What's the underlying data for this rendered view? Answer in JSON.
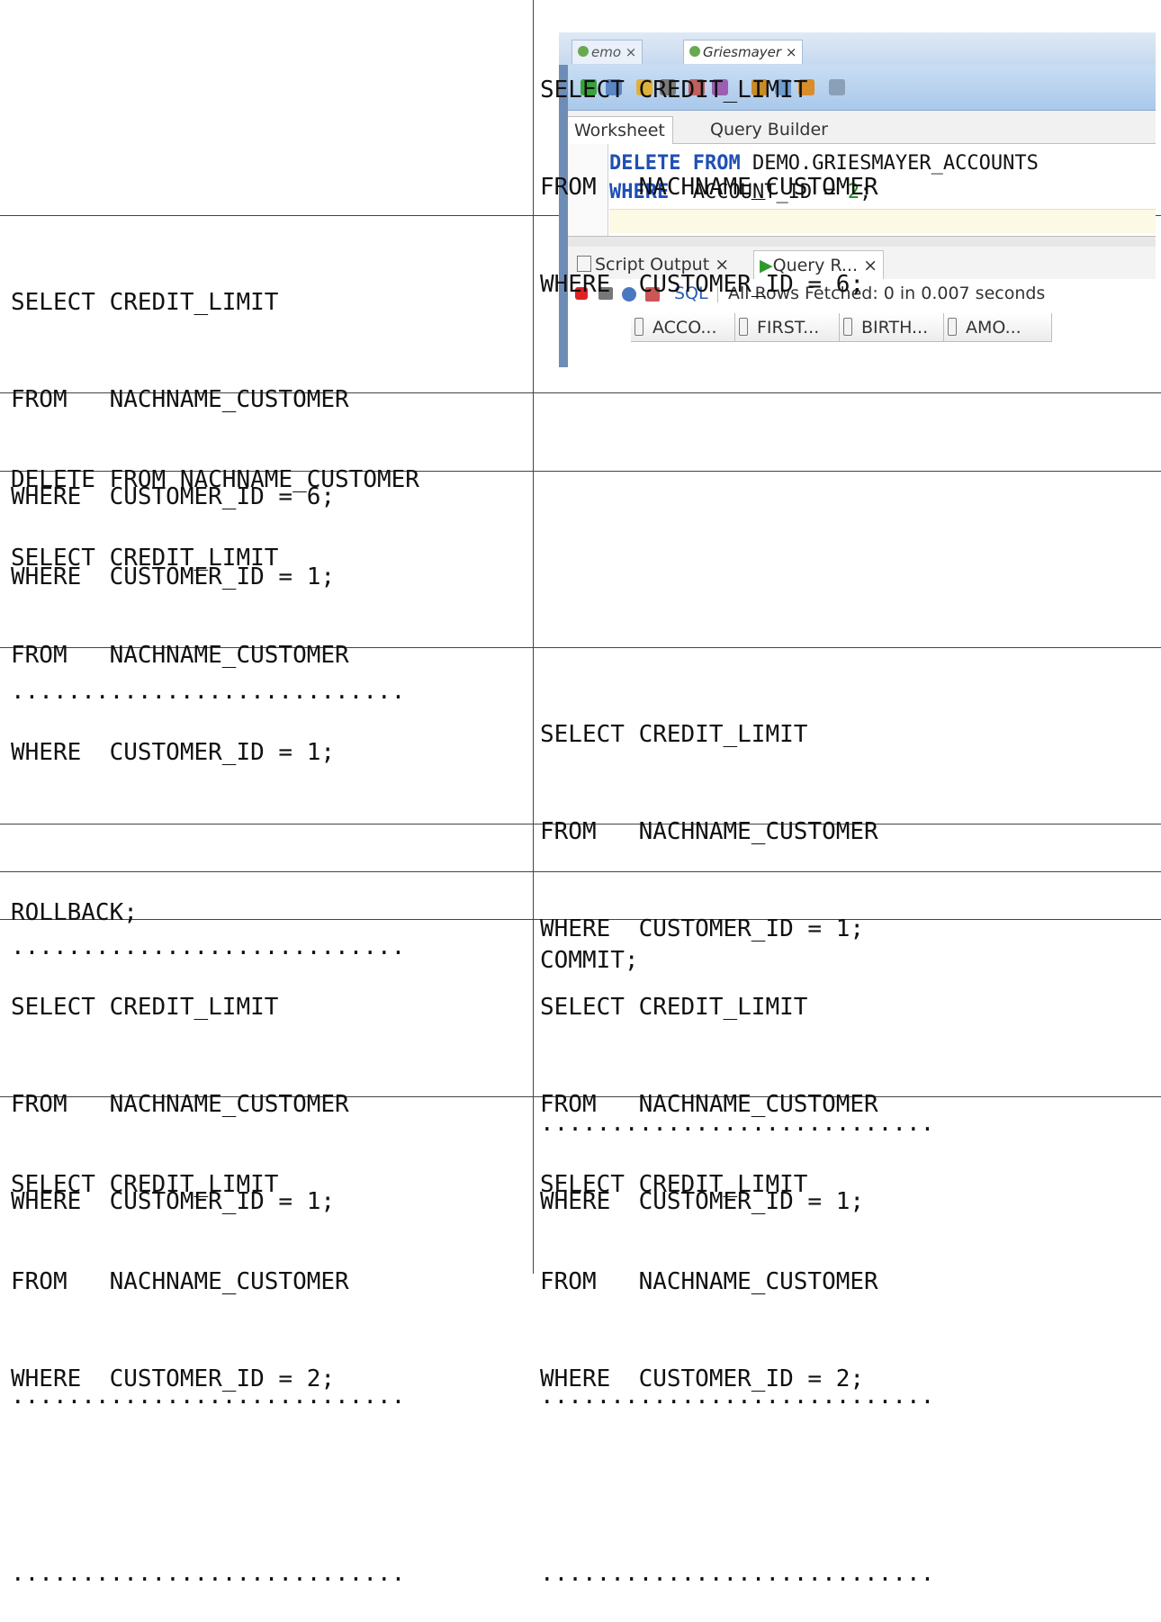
{
  "rows": [
    {
      "left": [],
      "right": [
        "SELECT CREDIT_LIMIT",
        "FROM   NACHNAME_CUSTOMER",
        "WHERE  CUSTOMER_ID = 6;"
      ],
      "right_dots": "............................"
    },
    {
      "left": [
        "SELECT CREDIT_LIMIT",
        "FROM   NACHNAME_CUSTOMER",
        "WHERE  CUSTOMER_ID = 6;"
      ],
      "left_dots": "............................",
      "right": []
    },
    {
      "left": [
        "DELETE FROM NACHNAME_CUSTOMER",
        "WHERE  CUSTOMER_ID = 1;"
      ],
      "right": []
    },
    {
      "left": [
        "SELECT CREDIT_LIMIT",
        "FROM   NACHNAME_CUSTOMER",
        "WHERE  CUSTOMER_ID = 1;"
      ],
      "left_dots": "............................",
      "right": []
    },
    {
      "left": [],
      "right": [
        "SELECT CREDIT_LIMIT",
        "FROM   NACHNAME_CUSTOMER",
        "WHERE  CUSTOMER_ID = 1;"
      ],
      "right_dots": "............................"
    },
    {
      "left": [
        "ROLLBACK;"
      ],
      "right": []
    },
    {
      "left": [],
      "right": [
        "COMMIT;"
      ]
    },
    {
      "left": [
        "SELECT CREDIT_LIMIT",
        "FROM   NACHNAME_CUSTOMER",
        "WHERE  CUSTOMER_ID = 1;"
      ],
      "left_dots": "............................",
      "right": [
        "SELECT CREDIT_LIMIT",
        "FROM   NACHNAME_CUSTOMER",
        "WHERE  CUSTOMER_ID = 1;"
      ],
      "right_dots": "............................"
    },
    {
      "left": [
        "SELECT CREDIT_LIMIT",
        "FROM   NACHNAME_CUSTOMER",
        "WHERE  CUSTOMER_ID = 2;"
      ],
      "left_dots": "............................",
      "right": [
        "SELECT CREDIT_LIMIT",
        "FROM   NACHNAME_CUSTOMER",
        "WHERE  CUSTOMER_ID = 2;"
      ],
      "right_dots": "............................"
    }
  ],
  "sqldev": {
    "doc_tabs": [
      "emo",
      "Griesmayer"
    ],
    "subtabs": [
      "Worksheet",
      "Query Builder"
    ],
    "editor": {
      "line1_kw1": "DELETE",
      "line1_kw2": "FROM",
      "line1_rest": "DEMO.GRIESMAYER_ACCOUNTS",
      "line2_kw": "WHERE",
      "line2_mid": "  ACCOUNT_ID = ",
      "line2_num": "2",
      "line2_end": ";"
    },
    "output_tabs": [
      "Script Output",
      "Query R..."
    ],
    "sql_link": "SQL",
    "status": "All Rows Fetched: 0 in 0.007 seconds",
    "columns": [
      "ACCO...",
      "FIRST...",
      "BIRTH...",
      "AMO..."
    ]
  }
}
